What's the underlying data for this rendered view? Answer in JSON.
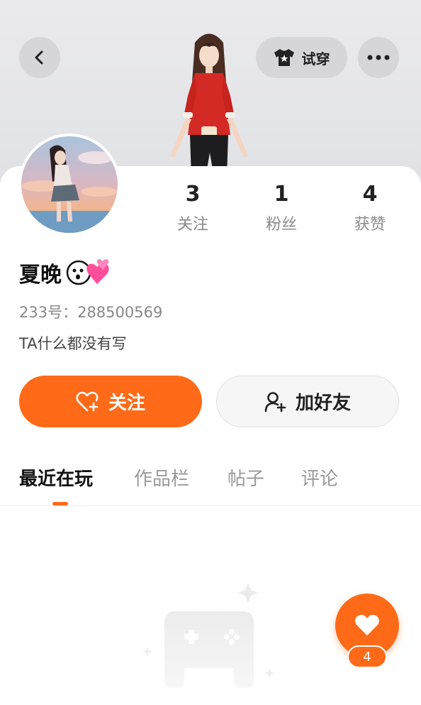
{
  "header": {
    "tryon_label": "试穿"
  },
  "profile": {
    "name": "夏晚",
    "uid": "233号：288500569",
    "bio": "TA什么都没有写"
  },
  "stats": [
    {
      "value": "3",
      "label": "关注"
    },
    {
      "value": "1",
      "label": "粉丝"
    },
    {
      "value": "4",
      "label": "获赞"
    }
  ],
  "actions": {
    "follow_label": "关注",
    "add_friend_label": "加好友"
  },
  "tabs": [
    {
      "label": "最近在玩",
      "active": true
    },
    {
      "label": "作品栏",
      "active": false
    },
    {
      "label": "帖子",
      "active": false
    },
    {
      "label": "评论",
      "active": false
    }
  ],
  "like": {
    "count": "4"
  },
  "colors": {
    "accent": "#fe6a17"
  },
  "icons": {
    "back": "chevron-left-icon",
    "tryon": "tshirt-icon",
    "more": "more-dots-icon",
    "follow": "heart-plus-icon",
    "add_friend": "user-plus-icon",
    "like": "heart-icon"
  }
}
